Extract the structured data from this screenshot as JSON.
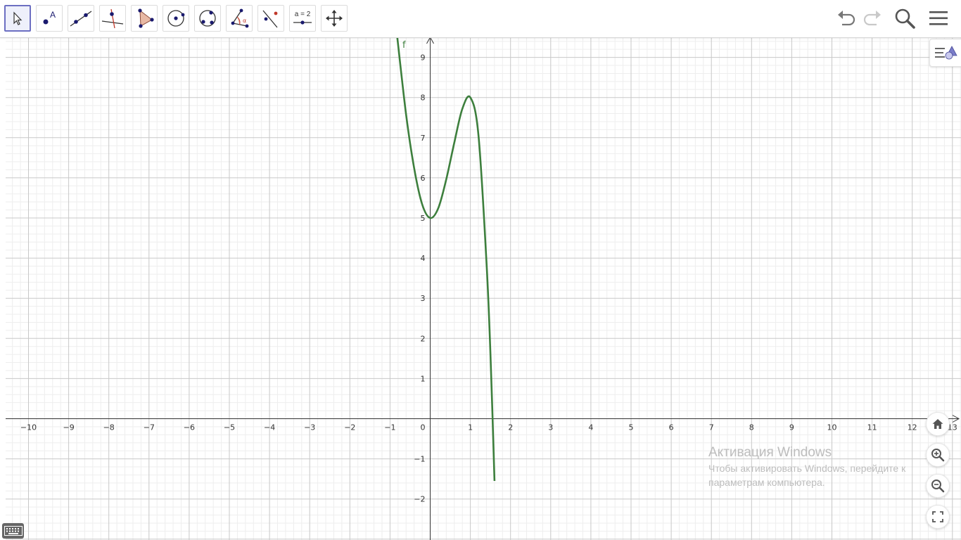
{
  "toolbar": {
    "tools": [
      {
        "name": "move-tool",
        "selected": true
      },
      {
        "name": "point-tool",
        "label": "A"
      },
      {
        "name": "line-tool"
      },
      {
        "name": "perpendicular-line-tool"
      },
      {
        "name": "polygon-tool"
      },
      {
        "name": "circle-center-point-tool"
      },
      {
        "name": "circle-three-points-tool"
      },
      {
        "name": "angle-tool",
        "label": "α"
      },
      {
        "name": "reflect-tool"
      },
      {
        "name": "slider-tool",
        "label": "a = 2"
      },
      {
        "name": "move-graphics-view-tool"
      }
    ],
    "actions": [
      "undo-icon",
      "redo-icon",
      "search-icon",
      "menu-icon"
    ]
  },
  "graph": {
    "function_label": "f",
    "curve_color": "#3d7f3d",
    "x_ticks": [
      "−10",
      "−9",
      "−8",
      "−7",
      "−6",
      "−5",
      "−4",
      "−3",
      "−2",
      "−1",
      "0",
      "1",
      "2",
      "3",
      "4",
      "5",
      "6",
      "7",
      "8",
      "9",
      "10",
      "11",
      "12",
      "13"
    ],
    "y_ticks": [
      "−2",
      "−1",
      "1",
      "2",
      "3",
      "4",
      "5",
      "6",
      "7",
      "8",
      "9"
    ]
  },
  "chart_data": {
    "type": "line",
    "title": "",
    "xlabel": "",
    "ylabel": "",
    "xlim": [
      -10.6,
      13.4
    ],
    "ylim": [
      -3,
      9.5
    ],
    "grid": true,
    "series": [
      {
        "name": "f",
        "x": [
          -0.82,
          -0.6,
          -0.4,
          -0.2,
          0,
          0.2,
          0.4,
          0.6,
          0.8,
          1.0,
          1.2,
          1.4,
          1.5,
          1.6
        ],
        "y": [
          9.5,
          7.58,
          6.24,
          5.34,
          5.0,
          5.24,
          5.96,
          6.88,
          7.72,
          8.0,
          7.08,
          3.93,
          1.63,
          -1.55
        ]
      }
    ]
  },
  "side_controls": [
    "style-bar-toggle-icon",
    "home-icon",
    "zoom-in-icon",
    "zoom-out-icon",
    "fullscreen-icon"
  ],
  "watermark": {
    "title": "Активация Windows",
    "subtitle": "Чтобы активировать Windows, перейдите к параметрам компьютера."
  },
  "keyboard": {
    "icon": "keyboard-icon"
  }
}
